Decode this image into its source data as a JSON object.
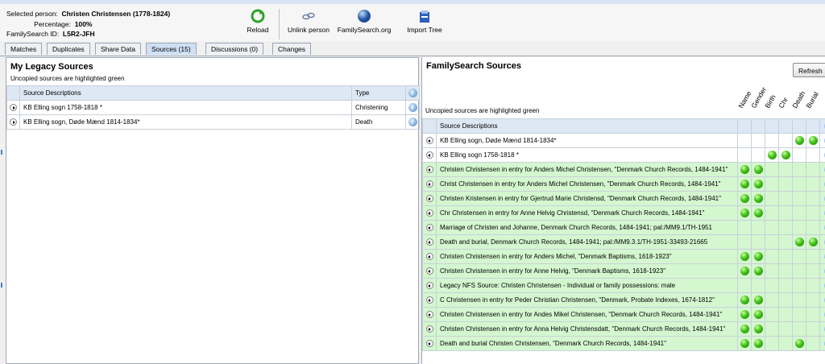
{
  "header": {
    "selected_person_label": "Selected person:",
    "selected_person_value": "Christen Christensen (1778-1824)",
    "percentage_label": "Percentage:",
    "percentage_value": "100%",
    "fs_id_label": "FamilySearch ID:",
    "fs_id_value": "L5R2-JFH"
  },
  "toolbar": {
    "reload": "Reload",
    "unlink": "Unlink person",
    "familysearch": "FamilySearch.org",
    "import_tree": "Import Tree"
  },
  "tabs": [
    "Matches",
    "Duplicates",
    "Share Data",
    "Sources (15)",
    "Discussions (0)",
    "Changes"
  ],
  "active_tab": "Sources (15)",
  "left": {
    "title": "My Legacy Sources",
    "subtitle": "Uncopied sources are highlighted green",
    "col_desc": "Source Descriptions",
    "col_type": "Type",
    "rows": [
      {
        "desc": "KB Elling sogn 1758-1818 *",
        "type": "Christening"
      },
      {
        "desc": "KB Elling sogn, Døde Mænd 1814-1834*",
        "type": "Death"
      }
    ]
  },
  "right": {
    "title": "FamilySearch Sources",
    "refresh": "Refresh",
    "subtitle": "Uncopied sources are highlighted green",
    "col_desc": "Source Descriptions",
    "columns": [
      "Name",
      "Gender",
      "Birth",
      "Chr",
      "Death",
      "Burial"
    ],
    "rows": [
      {
        "desc": "KB Elling sogn, Døde Mænd 1814-1834*",
        "green": false,
        "flags": [
          0,
          0,
          0,
          0,
          1,
          1
        ]
      },
      {
        "desc": "KB Elling sogn 1758-1818 *",
        "green": false,
        "flags": [
          0,
          0,
          1,
          1,
          0,
          0
        ]
      },
      {
        "desc": "Christen Christensen in entry for Anders Michel Christensen, \"Denmark Church Records, 1484-1941\"",
        "green": true,
        "flags": [
          1,
          1,
          0,
          0,
          0,
          0
        ]
      },
      {
        "desc": "Christ Christensen in entry for Anders Michel Christensen, \"Denmark Church Records, 1484-1941\"",
        "green": true,
        "flags": [
          1,
          1,
          0,
          0,
          0,
          0
        ]
      },
      {
        "desc": "Christen Kristensen in entry for Gjertrud Marie Christensd, \"Denmark Church Records, 1484-1941\"",
        "green": true,
        "flags": [
          1,
          1,
          0,
          0,
          0,
          0
        ]
      },
      {
        "desc": "Chr Christensen in entry for Anne Helvig Christensd, \"Denmark Church Records, 1484-1941\"",
        "green": true,
        "flags": [
          1,
          1,
          0,
          0,
          0,
          0
        ]
      },
      {
        "desc": "Marriage of Christen and Johanne, Denmark Church Records, 1484-1941; pal:/MM9.1/TH-1951",
        "green": true,
        "flags": [
          0,
          0,
          0,
          0,
          0,
          0
        ]
      },
      {
        "desc": "Death and burial, Denmark Church Records, 1484-1941; pal:/MM9.3.1/TH-1951-33493-21665",
        "green": true,
        "flags": [
          0,
          0,
          0,
          0,
          1,
          1
        ]
      },
      {
        "desc": "Christen Christensen in entry for Anders Michel, \"Denmark Baptisms, 1618-1923\"",
        "green": true,
        "flags": [
          1,
          1,
          0,
          0,
          0,
          0
        ]
      },
      {
        "desc": "Christen Christensen in entry for Anne Helvig, \"Denmark Baptisms, 1618-1923\"",
        "green": true,
        "flags": [
          1,
          1,
          0,
          0,
          0,
          0
        ]
      },
      {
        "desc": "Legacy NFS Source: Christen Christensen - Individual or family possessions: male",
        "green": true,
        "flags": [
          0,
          0,
          0,
          0,
          0,
          0
        ]
      },
      {
        "desc": "C Christensen in entry for Peder Christian Christensen, \"Denmark, Probate Indexes, 1674-1812\"",
        "green": true,
        "flags": [
          1,
          1,
          0,
          0,
          0,
          0
        ]
      },
      {
        "desc": "Christen Christensen in entry for Andes Mikel Christensen, \"Denmark Church Records, 1484-1941\"",
        "green": true,
        "flags": [
          1,
          1,
          0,
          0,
          0,
          0
        ]
      },
      {
        "desc": "Christen Christensen in entry for Anna Helvig Christensdatt, \"Denmark Church Records, 1484-1941\"",
        "green": true,
        "flags": [
          1,
          1,
          0,
          0,
          0,
          0
        ]
      },
      {
        "desc": "Death and burial Christen Christensen, \"Denmark Church Records, 1484-1941\"",
        "green": true,
        "flags": [
          1,
          1,
          0,
          0,
          1,
          0
        ]
      }
    ]
  }
}
